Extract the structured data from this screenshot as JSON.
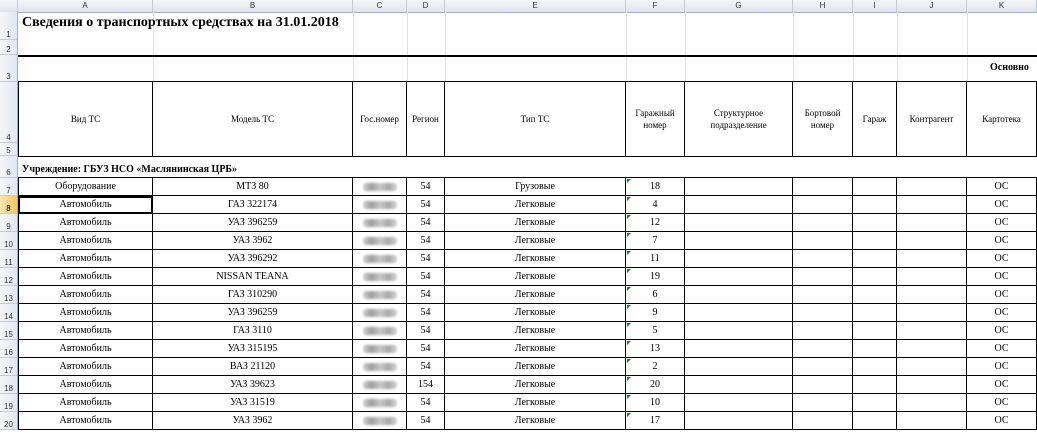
{
  "columns": [
    "A",
    "B",
    "C",
    "D",
    "E",
    "F",
    "G",
    "H",
    "I",
    "J",
    "K"
  ],
  "row_numbers": [
    "1",
    "2",
    "3",
    "4",
    "5",
    "6",
    "7",
    "8",
    "9",
    "10",
    "11",
    "12",
    "13",
    "14",
    "15",
    "16",
    "17",
    "18",
    "19",
    "20"
  ],
  "title": "Сведения о транспортных средствах на 31.01.2018",
  "section_label": "Основно",
  "headers": [
    "Вид ТС",
    "Модель ТС",
    "Гос.номер",
    "Регион",
    "Тип ТС",
    "Гаражный номер",
    "Структурное подразделение",
    "Бортовой номер",
    "Гараж",
    "Контрагент",
    "Картотека"
  ],
  "institution": "Учреждение: ГБУЗ НСО «Маслянинская ЦРБ»",
  "rows": [
    {
      "kind": "Оборудование",
      "model": "МТЗ 80",
      "region": "54",
      "type": "Грузовые",
      "garage_no": "18",
      "card": "ОС"
    },
    {
      "kind": "Автомобиль",
      "model": "ГАЗ 322174",
      "region": "54",
      "type": "Легковые",
      "garage_no": "4",
      "card": "ОС"
    },
    {
      "kind": "Автомобиль",
      "model": "УАЗ 396259",
      "region": "54",
      "type": "Легковые",
      "garage_no": "12",
      "card": "ОС"
    },
    {
      "kind": "Автомобиль",
      "model": "УАЗ 3962",
      "region": "54",
      "type": "Легковые",
      "garage_no": "7",
      "card": "ОС"
    },
    {
      "kind": "Автомобиль",
      "model": "УАЗ 396292",
      "region": "54",
      "type": "Легковые",
      "garage_no": "11",
      "card": "ОС"
    },
    {
      "kind": "Автомобиль",
      "model": "NISSAN TEANA",
      "region": "54",
      "type": "Легковые",
      "garage_no": "19",
      "card": "ОС"
    },
    {
      "kind": "Автомобиль",
      "model": "ГАЗ 310290",
      "region": "54",
      "type": "Легковые",
      "garage_no": "6",
      "card": "ОС"
    },
    {
      "kind": "Автомобиль",
      "model": "УАЗ 396259",
      "region": "54",
      "type": "Легковые",
      "garage_no": "9",
      "card": "ОС"
    },
    {
      "kind": "Автомобиль",
      "model": "ГАЗ 3110",
      "region": "54",
      "type": "Легковые",
      "garage_no": "5",
      "card": "ОС"
    },
    {
      "kind": "Автомобиль",
      "model": "УАЗ 315195",
      "region": "54",
      "type": "Легковые",
      "garage_no": "13",
      "card": "ОС"
    },
    {
      "kind": "Автомобиль",
      "model": "ВАЗ 21120",
      "region": "54",
      "type": "Легковые",
      "garage_no": "2",
      "card": "ОС"
    },
    {
      "kind": "Автомобиль",
      "model": "УАЗ 39623",
      "region": "154",
      "type": "Легковые",
      "garage_no": "20",
      "card": "ОС"
    },
    {
      "kind": "Автомобиль",
      "model": "УАЗ 31519",
      "region": "54",
      "type": "Легковые",
      "garage_no": "10",
      "card": "ОС"
    },
    {
      "kind": "Автомобиль",
      "model": "УАЗ 3962",
      "region": "54",
      "type": "Легковые",
      "garage_no": "17",
      "card": "ОС"
    }
  ]
}
